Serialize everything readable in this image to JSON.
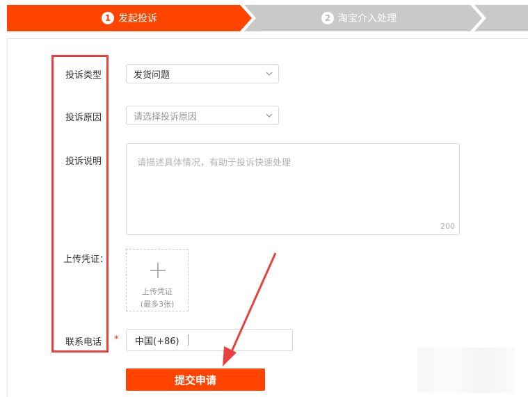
{
  "steps": [
    {
      "num": "1",
      "label": "发起投诉",
      "state": "active"
    },
    {
      "num": "2",
      "label": "淘宝介入处理",
      "state": "inactive"
    }
  ],
  "colors": {
    "accent": "#ff4400",
    "step_inactive": "#c9c9c9",
    "highlight": "#e8403c"
  },
  "form": {
    "type": {
      "label": "投诉类型",
      "value": "发货问题"
    },
    "reason": {
      "label": "投诉原因",
      "placeholder": "请选择投诉原因"
    },
    "description": {
      "label": "投诉说明",
      "placeholder": "请描述具体情况，有助于投诉快速处理",
      "max_count": "200"
    },
    "upload": {
      "label": "上传凭证：",
      "text": "上传凭证",
      "limit": "(最多3张)"
    },
    "phone": {
      "label": "联系电话",
      "required_mark": "*",
      "value": "中国(+86)"
    },
    "submit_label": "提交申请"
  }
}
